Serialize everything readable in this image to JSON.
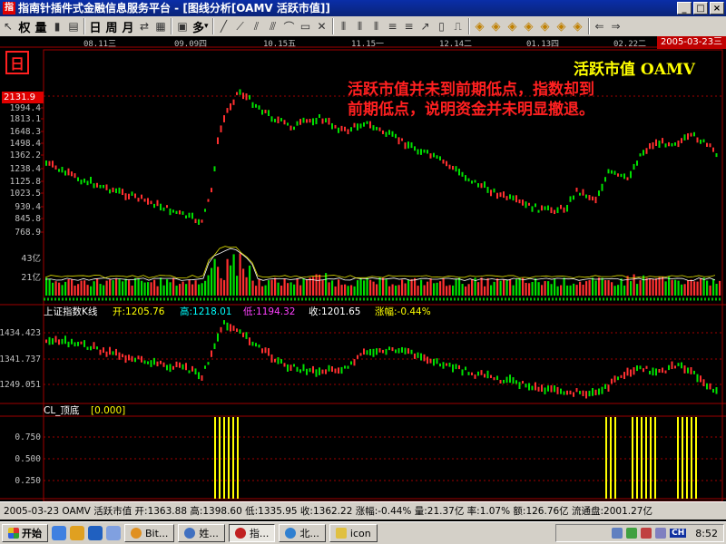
{
  "window": {
    "app_icon_glyph": "指",
    "title": "指南针插件式金融信息服务平台 - [图线分析[OAMV 活跃市值]]",
    "buttons": [
      "_",
      "□",
      "×"
    ]
  },
  "toolbar": {
    "items": [
      "权",
      "量",
      "日",
      "周",
      "月"
    ],
    "view_items": [
      "日",
      "周",
      "月"
    ],
    "multi_label": "多"
  },
  "chart": {
    "date_badge": "2005-03-23三",
    "period_glyph": "日",
    "indicator_title": "活跃市值 OAMV",
    "annotation_line1": "活跃市值并未到前期低点，指数却到",
    "annotation_line2": "前期低点，说明资金并未明显撤退。",
    "price_badge": "2131.9",
    "date_ticks": [
      "08.11三",
      "09.09四",
      "10.15五",
      "11.15一",
      "12.14二",
      "01.13四",
      "02.22二"
    ],
    "price_ticks": [
      "1994.4",
      "1813.1",
      "1648.3",
      "1498.4",
      "1362.2",
      "1238.4",
      "1125.8",
      "1023.5",
      "930.4",
      "845.8",
      "768.9"
    ],
    "volume_ticks": [
      "43亿",
      "21亿"
    ],
    "index_panel": {
      "name": "上证指数K线",
      "open_label": "开:",
      "open": "1205.76",
      "high_label": "高:",
      "high": "1218.01",
      "low_label": "低:",
      "low": "1194.32",
      "close_label": "收:",
      "close": "1201.65",
      "change_label": "涨幅:",
      "change": "-0.44%",
      "ticks": [
        "1434.423",
        "1341.737",
        "1249.051"
      ]
    },
    "signal_panel": {
      "name": "CL_顶底",
      "value": "[0.000]",
      "ticks": [
        "0.750",
        "0.500",
        "0.250"
      ]
    },
    "colors": {
      "up": "#ff3030",
      "down": "#00e000",
      "signal": "#ffff00"
    }
  },
  "status_bar": "2005-03-23  OAMV  活跃市值  开:1363.88  高:1398.60  低:1335.95  收:1362.22  涨幅:-0.44%  量:21.37亿  率:1.07%  额:126.76亿  流通盘:2001.27亿",
  "taskbar": {
    "start": "开始",
    "tasks": [
      "Bit...",
      "姓...",
      "指...",
      "北...",
      "icon"
    ],
    "clock": "8:52",
    "lang": "CH"
  }
}
